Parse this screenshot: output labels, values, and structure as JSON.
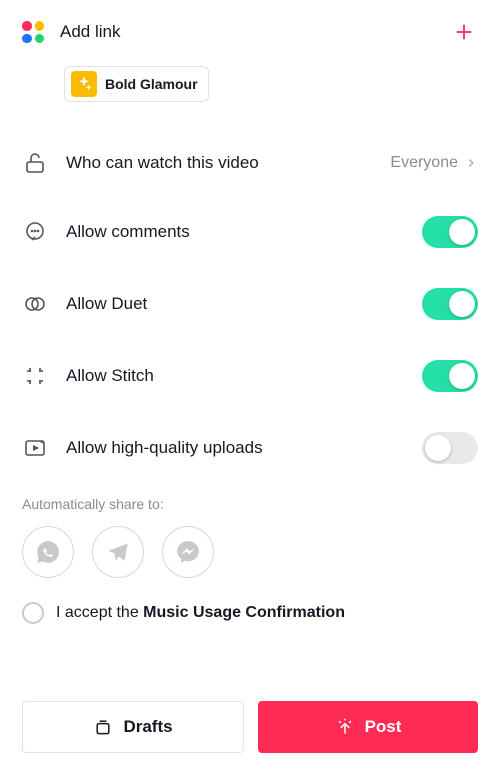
{
  "header": {
    "add_link_label": "Add link"
  },
  "effect_chip": {
    "label": "Bold Glamour"
  },
  "settings": {
    "audience": {
      "label": "Who can watch this video",
      "value": "Everyone"
    },
    "comments": {
      "label": "Allow comments",
      "on": true
    },
    "duet": {
      "label": "Allow Duet",
      "on": true
    },
    "stitch": {
      "label": "Allow Stitch",
      "on": true
    },
    "hq": {
      "label": "Allow high-quality uploads",
      "on": false
    }
  },
  "share": {
    "label": "Automatically share to:"
  },
  "music": {
    "prefix": "I accept the ",
    "bold": "Music Usage Confirmation",
    "checked": false
  },
  "buttons": {
    "drafts": "Drafts",
    "post": "Post"
  },
  "colors": {
    "accent": "#fe2c55",
    "toggle_on": "#25e0a6"
  }
}
